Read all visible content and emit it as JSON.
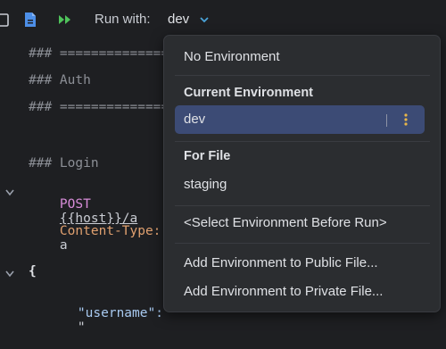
{
  "toolbar": {
    "run_with_label": "Run with:",
    "current_env": "dev",
    "icons": [
      "copy-icon",
      "file-icon",
      "run-all-icon",
      "chevron-down-icon"
    ]
  },
  "editor": {
    "lines": {
      "l1": "### ================================",
      "l2": "### Auth",
      "l3": "### ================================",
      "l4": "### Login",
      "l5_method": "POST",
      "l5_url": "{{host}}/a",
      "l6_key": "Content-Type:",
      "l6_val": "a",
      "l7": "{",
      "l8_key": "\"username\":",
      "l8_val": "\""
    }
  },
  "env_popup": {
    "no_env": "No Environment",
    "current_header": "Current Environment",
    "current_item": "dev",
    "for_file_header": "For File",
    "file_item": "staging",
    "select_before_run": "<Select Environment Before Run>",
    "add_public": "Add Environment to Public File...",
    "add_private": "Add Environment to Private File..."
  },
  "colors": {
    "accent": "#3c4b75",
    "kebab": "#e8b64a",
    "run_icon": "#4fc35b",
    "file_icon": "#4d8fe8"
  }
}
